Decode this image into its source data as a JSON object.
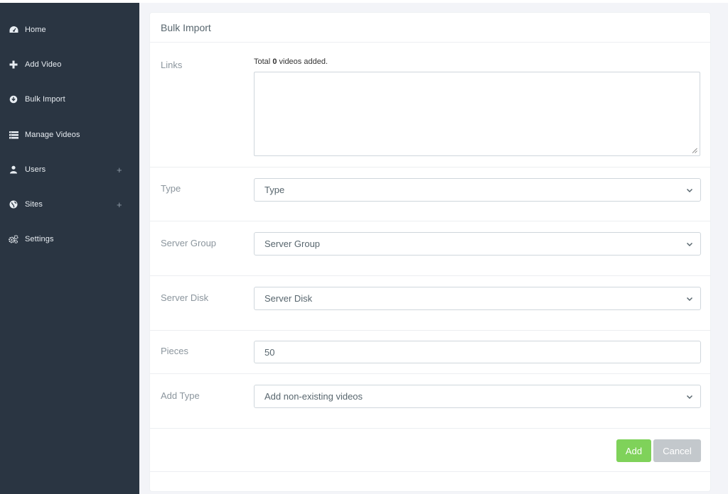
{
  "sidebar": {
    "items": [
      {
        "label": "Home",
        "icon": "dashboard-icon",
        "expandable": false
      },
      {
        "label": "Add Video",
        "icon": "plus-icon",
        "expandable": false
      },
      {
        "label": "Bulk Import",
        "icon": "download-circle-icon",
        "expandable": false
      },
      {
        "label": "Manage Videos",
        "icon": "list-icon",
        "expandable": false
      },
      {
        "label": "Users",
        "icon": "user-icon",
        "expandable": true,
        "expand_label": "+"
      },
      {
        "label": "Sites",
        "icon": "globe-icon",
        "expandable": true,
        "expand_label": "+"
      },
      {
        "label": "Settings",
        "icon": "gears-icon",
        "expandable": false
      }
    ]
  },
  "form": {
    "title": "Bulk Import",
    "links": {
      "label": "Links",
      "counter_prefix": "Total",
      "counter_value": "0",
      "counter_suffix": "videos added.",
      "value": ""
    },
    "type": {
      "label": "Type",
      "selected": "Type"
    },
    "server_group": {
      "label": "Server Group",
      "selected": "Server Group"
    },
    "server_disk": {
      "label": "Server Disk",
      "selected": "Server Disk"
    },
    "pieces": {
      "label": "Pieces",
      "value": "50"
    },
    "add_type": {
      "label": "Add Type",
      "selected": "Add non-existing videos"
    },
    "add_label": "Add",
    "cancel_label": "Cancel"
  },
  "colors": {
    "sidebar_bg": "#2a3542",
    "add_button": "#7fd25a",
    "cancel_button": "#c3c8cc",
    "page_bg": "#f3f4f8"
  }
}
